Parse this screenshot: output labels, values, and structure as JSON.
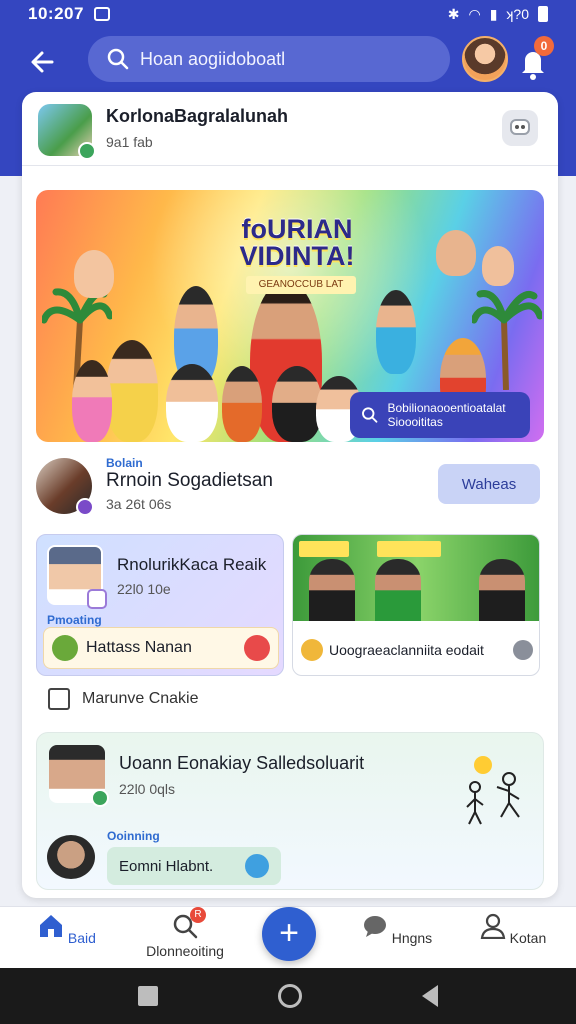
{
  "status_bar": {
    "time": "10:207",
    "right_text": "ʞ?0"
  },
  "header": {
    "search_placeholder": "Hoan aogiidoboatl",
    "notification_badge": "0"
  },
  "profile": {
    "name": "KorlonaBagralalunah",
    "meta": "9a1 fab"
  },
  "hero": {
    "title": "foURIAN VIDINTA!",
    "subtitle": "GEANOCCUB LAT",
    "chip_text": "Bobilionaooentioatalat Sioooititas"
  },
  "user": {
    "tag": "Bolain",
    "name": "Rrnoin Sogadietsan",
    "meta": "3a 26t 06s",
    "button_label": "Waheas"
  },
  "card_a": {
    "name": "RnolurikKaca Reaik",
    "meta": "22l0 10e",
    "tag": "Pmoating",
    "action_text": "Hattass Nanan"
  },
  "card_b": {
    "footer_text": "Uoograeaclanniita eodait"
  },
  "mark_row": {
    "label": "Marunve Cnakie"
  },
  "recommendation": {
    "name": "Uoann Eonakiay Salledsoluarit",
    "meta": "22l0 0qls",
    "tag": "Ooinning",
    "input_text": "Eomni Hlabnt."
  },
  "bottom_nav": {
    "items": [
      {
        "label": "Baid"
      },
      {
        "label": "Dlonneoiting"
      },
      {
        "label": "Hngns"
      },
      {
        "label": "Kotan"
      }
    ],
    "badge": "R",
    "fab_symbol": "+"
  },
  "colors": {
    "brand": "#3446c0",
    "accent": "#2f5fd0"
  }
}
